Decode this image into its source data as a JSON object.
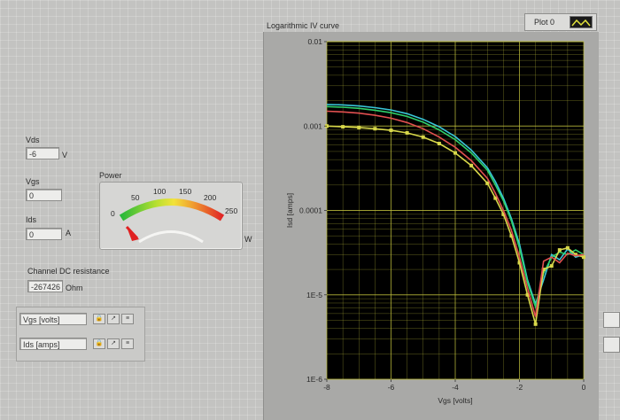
{
  "controls": {
    "vds": {
      "label": "Vds",
      "value": "-6",
      "unit": "V"
    },
    "vgs": {
      "label": "Vgs",
      "value": "0"
    },
    "ids": {
      "label": "Ids",
      "value": "0",
      "unit": "A"
    },
    "resistance": {
      "label": "Channel DC resistance",
      "value": "-267426",
      "unit": "Ohm"
    }
  },
  "power_meter": {
    "label": "Power",
    "unit": "W",
    "scale": [
      "0",
      "50",
      "100",
      "150",
      "200",
      "250"
    ],
    "value": 0
  },
  "scale_legend": {
    "x_name": "Vgs [volts]",
    "y_name": "Ids [amps]"
  },
  "graph": {
    "title": "Logarithmic IV curve",
    "plot_legend": "Plot 0",
    "colors": {
      "background": "#000000",
      "grid": "#b9b93a",
      "lines": [
        "#39c6d8",
        "#2ed06a",
        "#d8d84a",
        "#e25050"
      ]
    }
  },
  "chart_data": {
    "type": "line",
    "title": "Logarithmic IV curve",
    "xlabel": "Vgs [volts]",
    "ylabel": "Isd [amps]",
    "xlim": [
      -8,
      0
    ],
    "ylim": [
      1e-06,
      0.01
    ],
    "yscale": "log",
    "x_ticks": [
      "-8",
      "-6",
      "-4",
      "-2",
      "0"
    ],
    "y_ticks": [
      "1E-6",
      "1E-5",
      "0.0001",
      "0.001",
      "0.01"
    ],
    "grid": true,
    "series": [
      {
        "color": "#39c6d8",
        "markers": false,
        "x": [
          -8,
          -7.5,
          -7,
          -6.5,
          -6,
          -5.5,
          -5,
          -4.5,
          -4,
          -3.5,
          -3,
          -2.75,
          -2.5,
          -2.25,
          -2,
          -1.75,
          -1.5,
          -1.25,
          -1,
          -0.75,
          -0.5,
          -0.25,
          0
        ],
        "y": [
          0.0018,
          0.00178,
          0.00173,
          0.00165,
          0.00155,
          0.0014,
          0.0012,
          0.00098,
          0.00075,
          0.00052,
          0.00032,
          0.00022,
          0.00014,
          8e-05,
          4e-05,
          1.5e-05,
          7.8e-06,
          1.5e-05,
          3e-05,
          2.6e-05,
          3.5e-05,
          2.8e-05,
          3e-05
        ]
      },
      {
        "color": "#2ed06a",
        "markers": false,
        "x": [
          -8,
          -7.5,
          -7,
          -6.5,
          -6,
          -5.5,
          -5,
          -4.5,
          -4,
          -3.5,
          -3,
          -2.75,
          -2.5,
          -2.25,
          -2,
          -1.75,
          -1.5,
          -1.25,
          -1,
          -0.75,
          -0.5,
          -0.25,
          0
        ],
        "y": [
          0.0017,
          0.00167,
          0.00162,
          0.00154,
          0.00144,
          0.0013,
          0.00111,
          0.0009,
          0.00069,
          0.00048,
          0.0003,
          0.0002,
          0.00013,
          7.5e-05,
          3.6e-05,
          1.4e-05,
          7.2e-06,
          1.8e-05,
          2.8e-05,
          3.2e-05,
          3e-05,
          3.4e-05,
          3e-05
        ]
      },
      {
        "color": "#d8d84a",
        "markers": true,
        "x": [
          -8,
          -7.5,
          -7,
          -6.5,
          -6,
          -5.5,
          -5,
          -4.5,
          -4,
          -3.5,
          -3,
          -2.75,
          -2.5,
          -2.25,
          -2,
          -1.75,
          -1.5,
          -1.25,
          -1,
          -0.75,
          -0.5,
          -0.25,
          0
        ],
        "y": [
          0.001,
          0.00098,
          0.00096,
          0.00093,
          0.00089,
          0.00083,
          0.00074,
          0.00062,
          0.00048,
          0.00034,
          0.00021,
          0.00014,
          9e-05,
          5e-05,
          2.4e-05,
          1e-05,
          4.5e-06,
          2e-05,
          2.2e-05,
          3.4e-05,
          3.6e-05,
          3e-05,
          2.8e-05
        ]
      },
      {
        "color": "#e25050",
        "markers": false,
        "x": [
          -8,
          -7.5,
          -7,
          -6.5,
          -6,
          -5.5,
          -5,
          -4.5,
          -4,
          -3.5,
          -3,
          -2.75,
          -2.5,
          -2.25,
          -2,
          -1.75,
          -1.5,
          -1.25,
          -1,
          -0.75,
          -0.5,
          -0.25,
          0
        ],
        "y": [
          0.0015,
          0.00147,
          0.00142,
          0.00134,
          0.00124,
          0.0011,
          0.00093,
          0.00074,
          0.00056,
          0.00039,
          0.00024,
          0.00016,
          0.0001,
          5.8e-05,
          2.8e-05,
          1.2e-05,
          5.5e-06,
          2.5e-05,
          2.8e-05,
          2.4e-05,
          3.1e-05,
          2.9e-05,
          3e-05
        ]
      }
    ]
  }
}
